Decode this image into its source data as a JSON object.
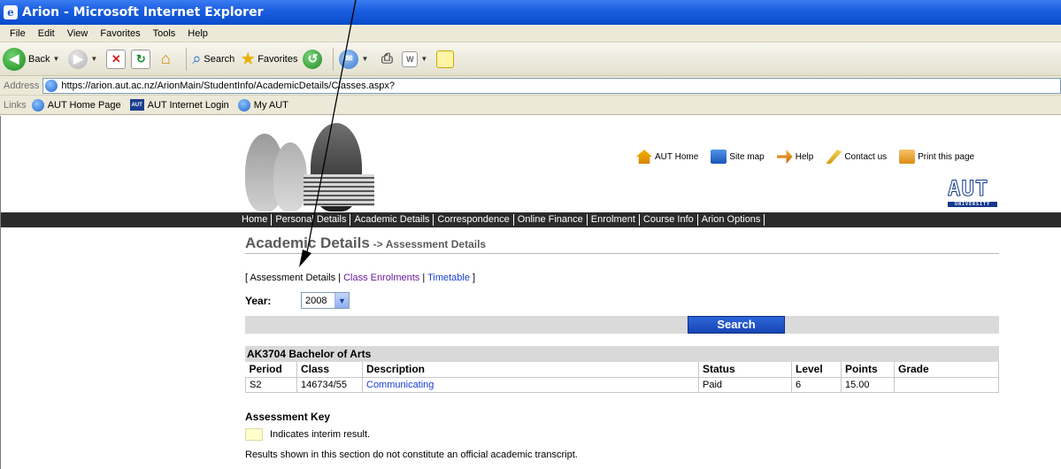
{
  "window": {
    "title": "Arion - Microsoft Internet Explorer"
  },
  "menu": [
    "File",
    "Edit",
    "View",
    "Favorites",
    "Tools",
    "Help"
  ],
  "toolbar": {
    "back": "Back",
    "search": "Search",
    "favorites": "Favorites"
  },
  "address": {
    "label": "Address",
    "url": "https://arion.aut.ac.nz/ArionMain/StudentInfo/AcademicDetails/Classes.aspx?"
  },
  "links": {
    "label": "Links",
    "items": [
      "AUT Home Page",
      "AUT Internet Login",
      "My AUT"
    ],
    "aut_icon": "AUT"
  },
  "header_links": [
    "AUT Home",
    "Site map",
    "Help",
    "Contact us",
    "Print this page"
  ],
  "logo": {
    "text": "AUT",
    "sub": "UNIVERSITY"
  },
  "nav": [
    "Home",
    "Personal Details",
    "Academic Details",
    "Correspondence",
    "Online Finance",
    "Enrolment",
    "Course Info",
    "Arion Options"
  ],
  "heading": {
    "main": "Academic Details",
    "sub": "-> Assessment Details"
  },
  "sublinks": {
    "open": "[",
    "assessment": "Assessment Details",
    "sep1": "|",
    "class_enrolments": "Class Enrolments",
    "sep2": "|",
    "timetable": "Timetable",
    "close": "]"
  },
  "year": {
    "label": "Year:",
    "value": "2008"
  },
  "search_button": "Search",
  "programme": "AK3704 Bachelor of Arts",
  "table": {
    "headers": [
      "Period",
      "Class",
      "Description",
      "Status",
      "Level",
      "Points",
      "Grade"
    ],
    "rows": [
      [
        "S2",
        "146734/55",
        "Communicating",
        "Paid",
        "6",
        "15.00",
        ""
      ]
    ]
  },
  "key": {
    "title": "Assessment Key",
    "interim": "Indicates interim result."
  },
  "disclaimer": "Results shown in this section do not constitute an official academic transcript.",
  "colors": {
    "title_bar": "#0a4ccb",
    "nav_bar": "#2b2b2b",
    "search_button": "#1846b5",
    "interim_swatch": "#ffffcc"
  }
}
